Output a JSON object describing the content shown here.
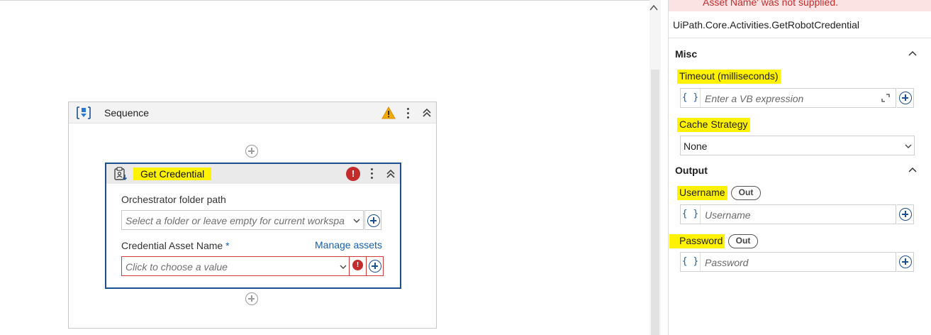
{
  "canvas": {
    "sequence": {
      "title": "Sequence"
    },
    "activity": {
      "title": "Get Credential",
      "folder_label": "Orchestrator folder path",
      "folder_placeholder": "Select a folder or leave empty for current workspa",
      "asset_label": "Credential Asset Name",
      "asset_required_mark": "*",
      "manage_assets_link": "Manage assets",
      "asset_placeholder": "Click to choose a value"
    }
  },
  "properties": {
    "error_text": "Asset Name' was not supplied.",
    "activity_type": "UiPath.Core.Activities.GetRobotCredential",
    "categories": {
      "misc": "Misc",
      "output": "Output"
    },
    "timeout": {
      "label": "Timeout (milliseconds)",
      "placeholder": "Enter a VB expression"
    },
    "cache_strategy": {
      "label": "Cache Strategy",
      "value": "None"
    },
    "username": {
      "label": "Username",
      "badge": "Out",
      "placeholder": "Username"
    },
    "password": {
      "label": "Password",
      "badge": "Out",
      "placeholder": "Password"
    },
    "brace_glyph": "{ }"
  },
  "colors": {
    "highlight": "#fff200",
    "activity_border": "#1e4f8f",
    "error": "#c42b2b",
    "link": "#1460aa"
  }
}
